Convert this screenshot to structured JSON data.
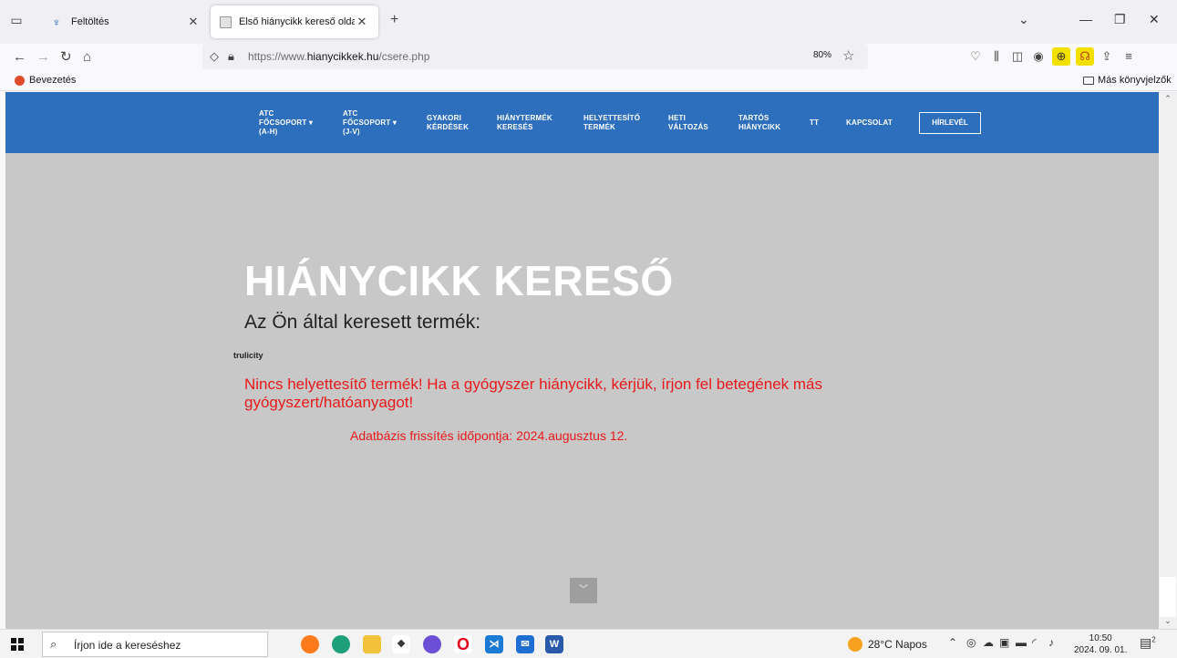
{
  "browser": {
    "tabs": [
      {
        "title": "Feltöltés",
        "active": false
      },
      {
        "title": "Első hiánycikk kereső oldal",
        "active": true
      }
    ],
    "url": {
      "prefix": "https://www.",
      "domain": "hianycikkek.hu",
      "path": "/csere.php"
    },
    "zoom": "80%",
    "bookmarks": {
      "left": "Bevezetés",
      "right": "Más könyvjelzők"
    }
  },
  "site": {
    "nav": [
      {
        "label_lines": [
          "ATC",
          "FŐCSOPORT ▾",
          "(A-H)"
        ]
      },
      {
        "label_lines": [
          "ATC",
          "FŐCSOPORT ▾",
          "(J-V)"
        ]
      },
      {
        "label_lines": [
          "GYAKORI",
          "KÉRDÉSEK"
        ]
      },
      {
        "label_lines": [
          "HIÁNYTERMÉK",
          "KERESÉS"
        ]
      },
      {
        "label_lines": [
          "HELYETTESÍTŐ",
          "TERMÉK"
        ]
      },
      {
        "label_lines": [
          "HETI",
          "VÁLTOZÁS"
        ]
      },
      {
        "label_lines": [
          "TARTÓS",
          "HIÁNYCIKK"
        ]
      },
      {
        "label_lines": [
          "TT"
        ]
      },
      {
        "label_lines": [
          "KAPCSOLAT"
        ]
      }
    ],
    "newsletter": "HÍRLEVÉL",
    "hero_title": "HIÁNYCIKK KERESŐ",
    "hero_subtitle": "Az Ön által keresett termék:",
    "product": "trulicity",
    "warning": "Nincs helyettesítő termék! Ha a gyógyszer hiánycikk, kérjük, írjon fel betegének más gyógyszert/hatóanyagot!",
    "update": "Adatbázis frissítés időpontja: 2024.augusztus 12.",
    "accent": "#2d6fbd",
    "warning_color": "#e8191a"
  },
  "taskbar": {
    "search_placeholder": "Írjon ide a kereséshez",
    "weather": "28°C Napos",
    "time": "10:50",
    "date": "2024. 09. 01.",
    "notification_count": "2"
  }
}
